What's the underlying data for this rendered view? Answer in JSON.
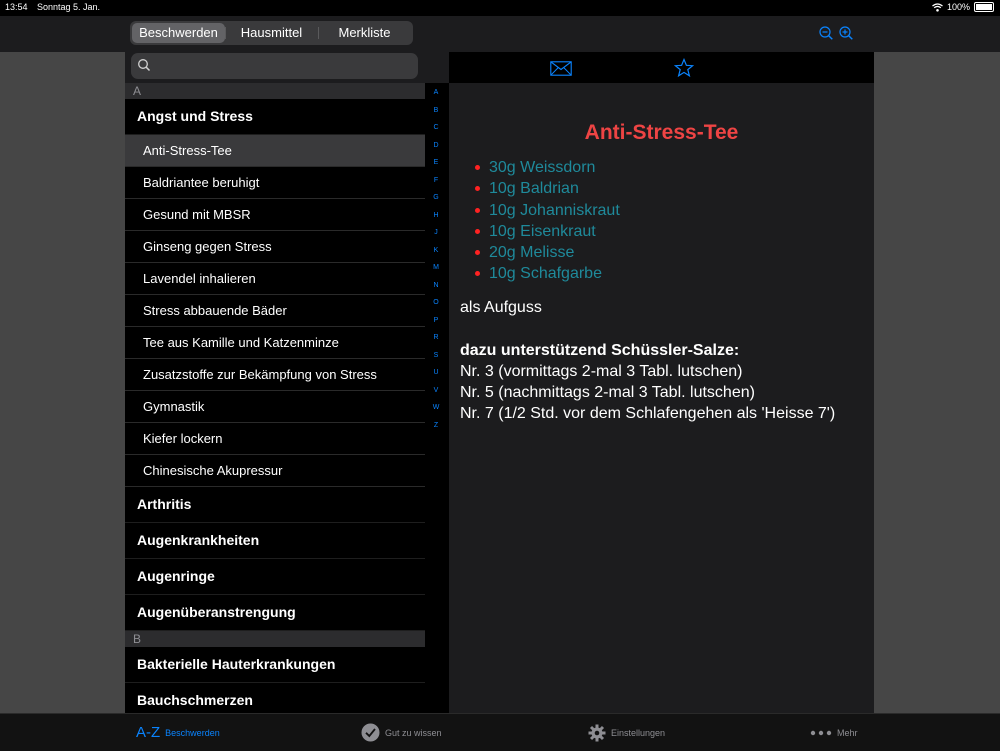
{
  "status": {
    "time": "13:54",
    "date": "Sonntag 5. Jan.",
    "battery": "100%"
  },
  "segments": [
    {
      "label": "Beschwerden",
      "active": true
    },
    {
      "label": "Hausmittel",
      "active": false
    },
    {
      "label": "Merkliste",
      "active": false
    }
  ],
  "search": {
    "placeholder": ""
  },
  "list": {
    "header_a": "A",
    "group_angst": "Angst und Stress",
    "items": [
      "Anti-Stress-Tee",
      "Baldriantee beruhigt",
      "Gesund mit MBSR",
      "Ginseng gegen Stress",
      "Lavendel inhalieren",
      "Stress abbauende Bäder",
      "Tee aus Kamille und Katzenminze",
      "Zusatzstoffe zur Bekämpfung von Stress",
      "Gymnastik",
      "Kiefer lockern",
      "Chinesische Akupressur"
    ],
    "groups_a": [
      "Arthritis",
      "Augenkrankheiten",
      "Augenringe",
      "Augenüberanstrengung"
    ],
    "header_b": "B",
    "groups_b": [
      "Bakterielle Hauterkrankungen",
      "Bauchschmerzen"
    ]
  },
  "index": [
    "A",
    "B",
    "C",
    "D",
    "E",
    "F",
    "G",
    "H",
    "J",
    "K",
    "M",
    "N",
    "O",
    "P",
    "R",
    "S",
    "U",
    "V",
    "W",
    "Z"
  ],
  "detail": {
    "title": "Anti-Stress-Tee",
    "ingredients": [
      "30g Weissdorn",
      "10g Baldrian",
      "10g Johanniskraut",
      "10g Eisenkraut",
      "20g Melisse",
      "10g Schafgarbe"
    ],
    "usage": "als Aufguss",
    "schuessler_heading": "dazu unterstützend Schüssler-Salze:",
    "schuessler_lines": [
      "Nr. 3 (vormittags 2-mal 3 Tabl. lutschen)",
      "Nr. 5 (nachmittags 2-mal 3 Tabl. lutschen)",
      "Nr. 7 (1/2 Std. vor dem Schlafengehen als 'Heisse 7')"
    ]
  },
  "tabs": {
    "az": "A-Z",
    "beschwerden": "Beschwerden",
    "gut": "Gut zu wissen",
    "einstellungen": "Einstellungen",
    "mehr": "Mehr"
  },
  "colors": {
    "accent": "#0a84ff",
    "title": "#ee4444",
    "ingredient": "#1f8a9b",
    "bullet": "#ff2222"
  }
}
